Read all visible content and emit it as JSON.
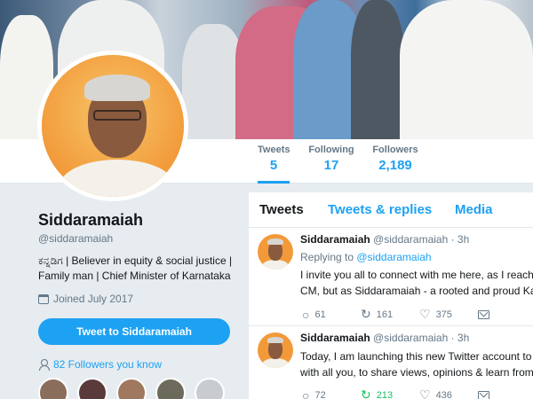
{
  "stats": [
    {
      "label": "Tweets",
      "value": "5"
    },
    {
      "label": "Following",
      "value": "17"
    },
    {
      "label": "Followers",
      "value": "2,189"
    }
  ],
  "profile": {
    "name": "Siddaramaiah",
    "handle": "@siddaramaiah",
    "bio_line1": "ಕನ್ನಡಿಗ | Believer in equity & social justice |",
    "bio_line2": "Family man | Chief Minister of Karnataka",
    "joined": "Joined July 2017",
    "tweet_to_label": "Tweet to Siddaramaiah",
    "followers_you_know": "82 Followers you know"
  },
  "tabs": [
    "Tweets",
    "Tweets & replies",
    "Media"
  ],
  "tweets": [
    {
      "name": "Siddaramaiah",
      "meta": "@siddaramaiah · 3h",
      "reply_prefix": "Replying to ",
      "reply_to": "@siddaramaiah",
      "line1": "I invite you all to connect with me here, as I reach o",
      "line2": "CM, but as Siddaramaiah - a rooted and proud Kan",
      "replies": "61",
      "retweets": "161",
      "likes": "375"
    },
    {
      "name": "Siddaramaiah",
      "meta": "@siddaramaiah · 3h",
      "line1": "Today, I am launching this new Twitter account to st",
      "line2": "with all you, to share views, opinions & learn from e",
      "replies": "72",
      "retweets": "213",
      "likes": "436"
    }
  ],
  "icons": {
    "reply": "reply-icon",
    "retweet": "retweet-icon",
    "like": "heart-icon",
    "dm": "mail-icon"
  },
  "colors": {
    "accent": "#1da1f2",
    "retweeted": "#17bf63"
  }
}
